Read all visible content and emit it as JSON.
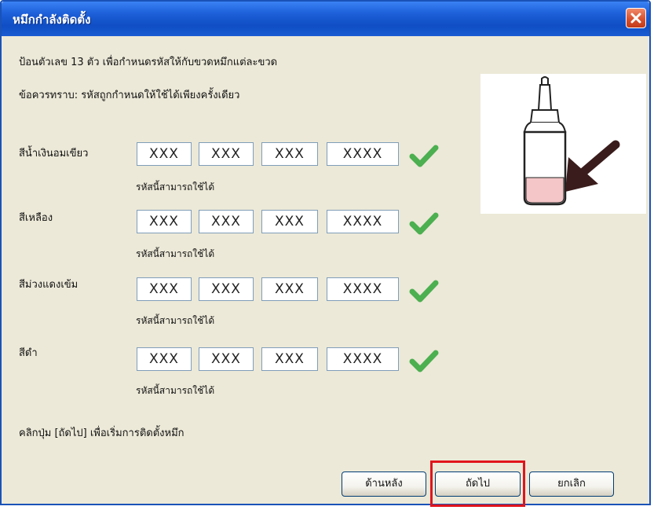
{
  "window": {
    "title": "หมึกกำลังติดตั้ง",
    "close_icon": "close-icon"
  },
  "instructions": {
    "line1": "ป้อนตัวเลข 13 ตัว เพื่อกำหนดรหัสให้กับขวดหมึกแต่ละขวด",
    "line2": "ข้อควรทราบ: รหัสถูกกำหนดให้ใช้ได้เพียงครั้งเดียว"
  },
  "ink_rows": [
    {
      "label": "สีน้ำเงินอมเขียว",
      "codes": [
        "XXX",
        "XXX",
        "XXX",
        "XXXX"
      ],
      "status": "รหัสนี้สามารถใช้ได้"
    },
    {
      "label": "สีเหลือง",
      "codes": [
        "XXX",
        "XXX",
        "XXX",
        "XXXX"
      ],
      "status": "รหัสนี้สามารถใช้ได้"
    },
    {
      "label": "สีม่วงแดงเข้ม",
      "codes": [
        "XXX",
        "XXX",
        "XXX",
        "XXXX"
      ],
      "status": "รหัสนี้สามารถใช้ได้"
    },
    {
      "label": "สีดำ",
      "codes": [
        "XXX",
        "XXX",
        "XXX",
        "XXXX"
      ],
      "status": "รหัสนี้สามารถใช้ได้"
    }
  ],
  "footer": {
    "hint": "คลิกปุ่ม [ถัดไป] เพื่อเริ่มการติดตั้งหมึก"
  },
  "buttons": {
    "back": "ด้านหลัง",
    "next": "ถัดไป",
    "cancel": "ยกเลิก"
  },
  "colors": {
    "titlebar": "#1d5fd8",
    "check": "#4caf50",
    "highlight": "#e0141c",
    "ink_level": "#f4c6c8"
  }
}
